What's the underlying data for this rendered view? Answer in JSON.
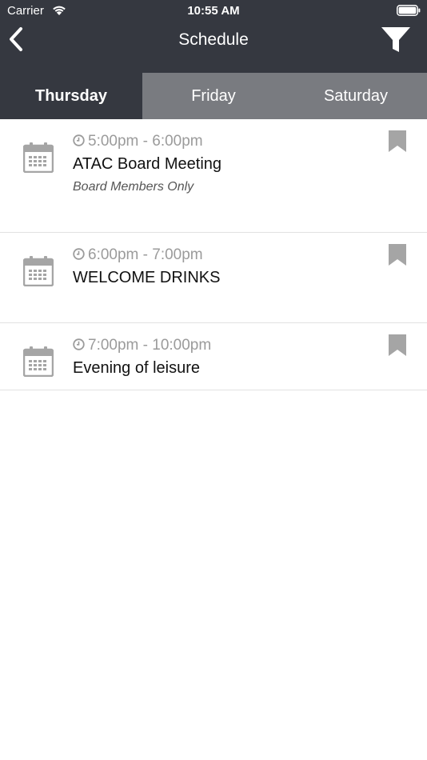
{
  "status_bar": {
    "carrier": "Carrier",
    "time": "10:55 AM"
  },
  "nav": {
    "title": "Schedule"
  },
  "tabs": [
    {
      "label": "Thursday",
      "active": true
    },
    {
      "label": "Friday",
      "active": false
    },
    {
      "label": "Saturday",
      "active": false
    }
  ],
  "events": [
    {
      "time": "5:00pm - 6:00pm",
      "title": "ATAC Board Meeting",
      "subtitle": "Board Members Only"
    },
    {
      "time": "6:00pm - 7:00pm",
      "title": "WELCOME DRINKS"
    },
    {
      "time": "7:00pm - 10:00pm",
      "title": "Evening of leisure"
    }
  ],
  "colors": {
    "header_bg": "#353840",
    "inactive_tab_bg": "#797b80",
    "icon_gray": "#a5a5a5"
  }
}
